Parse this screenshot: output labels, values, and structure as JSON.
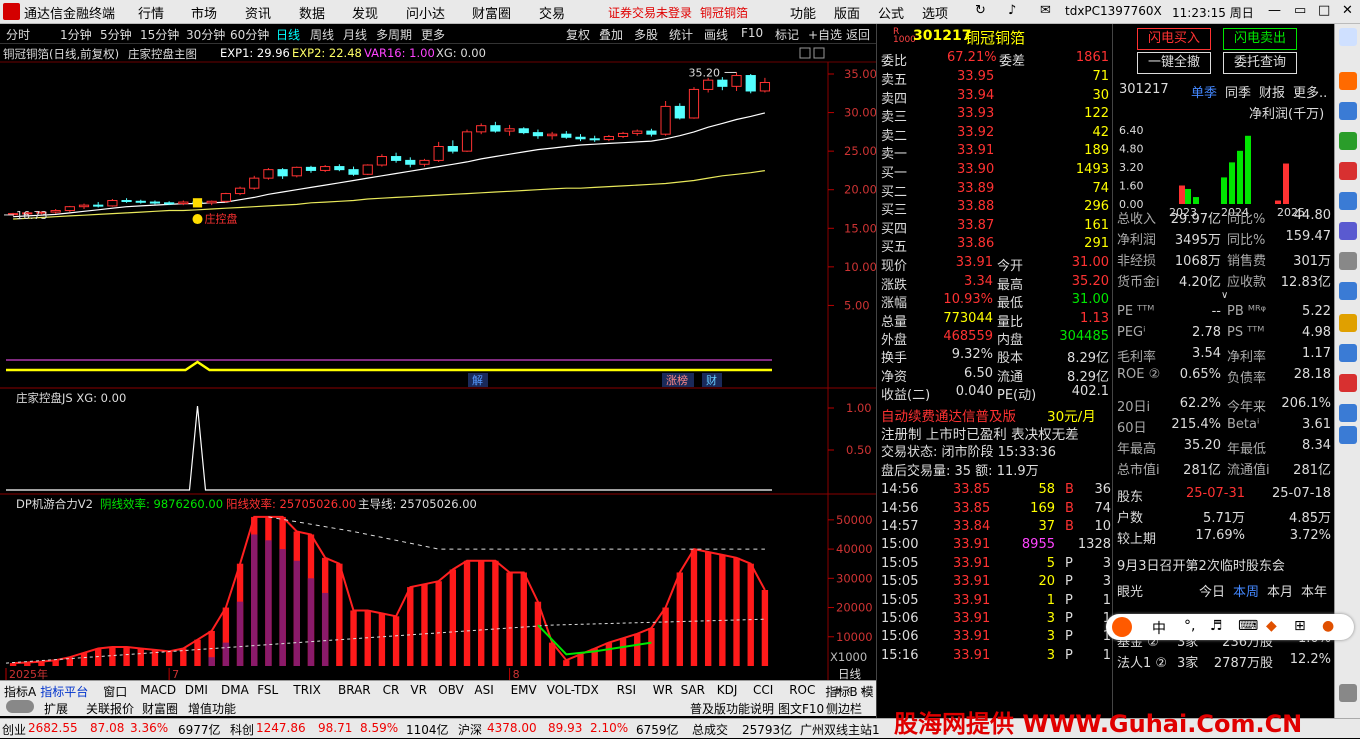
{
  "menu": {
    "app_title": "通达信金融终端",
    "items": [
      "行情",
      "市场",
      "资讯",
      "数据",
      "发现",
      "问小达",
      "财富圈",
      "交易"
    ],
    "login_notice": "证券交易未登录",
    "stock_short": "铜冠铜箔",
    "right_items": [
      "功能",
      "版面",
      "公式",
      "选项"
    ],
    "terminal_id": "tdxPC1397760X",
    "clock": "11:23:15 周日"
  },
  "periods": [
    "分时",
    "1分钟",
    "5分钟",
    "15分钟",
    "30分钟",
    "60分钟",
    "日线",
    "周线",
    "月线",
    "多周期",
    "更多"
  ],
  "toolbar_right": [
    "复权",
    "叠加",
    "多股",
    "统计",
    "画线",
    "F10",
    "标记",
    "+自选",
    "返回"
  ],
  "main_panel": {
    "stock_label": "铜冠铜箔(日线,前复权)",
    "indicator": "庄家控盘主图",
    "exp1": "EXP1: 29.96",
    "exp2": "EXP2: 22.48",
    "var16": "VAR16: 1.00",
    "xg": "XG: 0.00",
    "max_label": "35.20",
    "min_label": "16.73",
    "signal_label": "庄控盘",
    "y_ticks": [
      "35.00",
      "30.00",
      "25.00",
      "20.00",
      "15.00",
      "10.00",
      "5.00"
    ],
    "tags": [
      "解",
      "涨榜",
      "财"
    ]
  },
  "sub1": {
    "title": "庄家控盘JS  XG: 0.00",
    "y_ticks": [
      "1.00",
      "0.50"
    ]
  },
  "sub2": {
    "title": "DP机游合力V2",
    "yin": "阴线效率: 9876260.00",
    "yang": "阳线效率: 25705026.00",
    "main": "主导线: 25705026.00",
    "y_ticks": [
      "50000",
      "40000",
      "30000",
      "20000",
      "10000"
    ],
    "unit": "X1000",
    "period_label": "日线",
    "x_labels": [
      "2025年",
      "7",
      "8"
    ]
  },
  "chart_data": {
    "type": "candlestick",
    "ylim": [
      0,
      37
    ],
    "candles": [
      [
        16.8,
        17,
        16.6,
        16.9
      ],
      [
        16.9,
        17.1,
        16.7,
        17
      ],
      [
        17,
        17.2,
        16.8,
        17.1
      ],
      [
        17.1,
        17.5,
        16.9,
        17.3
      ],
      [
        17.3,
        17.9,
        17.1,
        17.8
      ],
      [
        17.8,
        18.2,
        17.5,
        18
      ],
      [
        18,
        18.4,
        17.7,
        17.9
      ],
      [
        17.9,
        18.8,
        17.8,
        18.6
      ],
      [
        18.6,
        18.9,
        18.3,
        18.5
      ],
      [
        18.5,
        18.7,
        18.2,
        18.4
      ],
      [
        18.4,
        18.6,
        18.1,
        18.3
      ],
      [
        18.3,
        18.5,
        18,
        18.2
      ],
      [
        18.2,
        18.6,
        18,
        18.4
      ],
      [
        18.4,
        18.6,
        18.1,
        18.3
      ],
      [
        18.3,
        18.6,
        18,
        18.5
      ],
      [
        18.5,
        19.6,
        18.3,
        19.5
      ],
      [
        19.5,
        20.4,
        19.3,
        20.2
      ],
      [
        20.2,
        21.8,
        20,
        21.5
      ],
      [
        21.5,
        22.8,
        21.3,
        22.6
      ],
      [
        22.6,
        22.8,
        21.4,
        21.8
      ],
      [
        21.8,
        23,
        21.6,
        22.9
      ],
      [
        22.9,
        23.1,
        22.2,
        22.5
      ],
      [
        22.5,
        23.2,
        22.3,
        23
      ],
      [
        23,
        23.3,
        22.4,
        22.6
      ],
      [
        22.6,
        23,
        21.8,
        22
      ],
      [
        22,
        23.3,
        21.9,
        23.2
      ],
      [
        23.2,
        24.6,
        23,
        24.3
      ],
      [
        24.3,
        24.8,
        23.5,
        23.8
      ],
      [
        23.8,
        24.2,
        22.9,
        23.3
      ],
      [
        23.3,
        24,
        23,
        23.8
      ],
      [
        23.8,
        26.2,
        23.6,
        25.6
      ],
      [
        25.6,
        26.4,
        24.7,
        25
      ],
      [
        25,
        27.8,
        24.9,
        27.5
      ],
      [
        27.5,
        28.6,
        27.2,
        28.3
      ],
      [
        28.3,
        28.8,
        27.4,
        27.6
      ],
      [
        27.6,
        28.4,
        27,
        27.9
      ],
      [
        27.9,
        28.1,
        27.2,
        27.4
      ],
      [
        27.4,
        27.8,
        26.6,
        27
      ],
      [
        27,
        27.5,
        26.5,
        27.2
      ],
      [
        27.2,
        27.6,
        26.6,
        26.8
      ],
      [
        26.8,
        27.2,
        26.3,
        26.6
      ],
      [
        26.6,
        27,
        26.2,
        26.5
      ],
      [
        26.5,
        27.1,
        26.3,
        26.9
      ],
      [
        26.9,
        27.5,
        26.7,
        27.3
      ],
      [
        27.3,
        27.8,
        27,
        27.6
      ],
      [
        27.6,
        27.9,
        26.9,
        27.2
      ],
      [
        27.2,
        31.5,
        27,
        30.8
      ],
      [
        30.8,
        31.2,
        29.1,
        29.3
      ],
      [
        29.3,
        33.3,
        29.2,
        33
      ],
      [
        33,
        34.5,
        32.6,
        34.2
      ],
      [
        34.2,
        34.6,
        32.9,
        33.4
      ],
      [
        33.4,
        35.2,
        32.8,
        34.8
      ],
      [
        34.8,
        35,
        32.5,
        32.8
      ],
      [
        32.8,
        34.5,
        32.6,
        33.9
      ]
    ],
    "ma_short": [
      16.5,
      16.6,
      16.7,
      16.8,
      17,
      17.2,
      17.4,
      17.6,
      17.8,
      17.9,
      18,
      18.1,
      18.2,
      18.2,
      18.3,
      18.4,
      18.7,
      19,
      19.4,
      19.7,
      20,
      20.3,
      20.6,
      20.9,
      21.2,
      21.5,
      21.8,
      22.1,
      22.4,
      22.7,
      23,
      23.3,
      23.6,
      24,
      24.3,
      24.6,
      24.9,
      25.2,
      25.4,
      25.6,
      25.8,
      25.9,
      26,
      26.1,
      26.2,
      26.3,
      26.6,
      27,
      27.5,
      28.1,
      28.6,
      29.1,
      29.5,
      29.96
    ],
    "ma_long": [
      16.2,
      16.3,
      16.4,
      16.5,
      16.6,
      16.7,
      16.8,
      16.9,
      17,
      17.1,
      17.2,
      17.3,
      17.3,
      17.4,
      17.5,
      17.6,
      17.7,
      17.8,
      17.9,
      18,
      18.1,
      18.3,
      18.4,
      18.5,
      18.6,
      18.8,
      18.9,
      19,
      19.1,
      19.2,
      19.3,
      19.4,
      19.5,
      19.6,
      19.7,
      19.8,
      19.9,
      20,
      20.1,
      20.2,
      20.2,
      20.3,
      20.4,
      20.5,
      20.6,
      20.7,
      20.8,
      21,
      21.2,
      21.5,
      21.8,
      22,
      22.2,
      22.48
    ],
    "signal_index": 13,
    "js_spike_index": 13,
    "force_values": [
      1000,
      1200,
      1500,
      2000,
      3000,
      4500,
      6000,
      6500,
      6500,
      6000,
      5500,
      5000,
      6000,
      9000,
      12000,
      20000,
      35000,
      51000,
      51000,
      51000,
      46000,
      45000,
      37000,
      35000,
      19000,
      19000,
      18000,
      17000,
      27000,
      28000,
      29000,
      33000,
      36000,
      36000,
      36000,
      32000,
      32000,
      22000,
      8000,
      2000,
      4000,
      6000,
      8000,
      9500,
      11000,
      13000,
      20000,
      32000,
      40000,
      39000,
      38000,
      37000,
      35000,
      26000
    ],
    "force_purple": [
      0,
      0,
      0,
      0,
      0,
      0,
      0,
      0,
      0,
      0,
      0,
      0,
      0,
      0,
      3000,
      8000,
      22000,
      45000,
      43000,
      40000,
      36000,
      30000,
      25000,
      0,
      0,
      0,
      0,
      0,
      0,
      0,
      0,
      0,
      0,
      0,
      0,
      0,
      0,
      0,
      0,
      0,
      0,
      0,
      0,
      0,
      0,
      0,
      0,
      0,
      0,
      0,
      0,
      0,
      0,
      0
    ]
  },
  "quote": {
    "code": "301217",
    "name": "铜冠铜箔",
    "badge": "R",
    "weibi_label": "委比",
    "weibi": "67.21%",
    "weicha_label": "委差",
    "weicha": "1861",
    "asks": [
      [
        "卖五",
        "33.95",
        "71"
      ],
      [
        "卖四",
        "33.94",
        "30"
      ],
      [
        "卖三",
        "33.93",
        "122"
      ],
      [
        "卖二",
        "33.92",
        "42"
      ],
      [
        "卖一",
        "33.91",
        "189"
      ]
    ],
    "bids": [
      [
        "买一",
        "33.90",
        "1493"
      ],
      [
        "买二",
        "33.89",
        "74"
      ],
      [
        "买三",
        "33.88",
        "296"
      ],
      [
        "买四",
        "33.87",
        "161"
      ],
      [
        "买五",
        "33.86",
        "291"
      ]
    ],
    "stats": [
      [
        "现价",
        "33.91",
        "今开",
        "31.00"
      ],
      [
        "涨跌",
        "3.34",
        "最高",
        "35.20"
      ],
      [
        "涨幅",
        "10.93%",
        "最低",
        "31.00"
      ],
      [
        "总量",
        "773044",
        "量比",
        "1.13"
      ],
      [
        "外盘",
        "468559",
        "内盘",
        "304485"
      ],
      [
        "换手",
        "9.32%",
        "股本",
        "8.29亿"
      ],
      [
        "净资",
        "6.50",
        "流通",
        "8.29亿"
      ],
      [
        "收益(二)",
        "0.040",
        "PE(动)",
        "402.1"
      ]
    ],
    "ad1": "自动续费通达信普及版",
    "ad1_price": "30元/月",
    "ad2": "注册制 上市时已盈利 表决权无差",
    "trade_state": "交易状态: 闭市阶段 15:33:36",
    "after_hours": "盘后交易量: 35  额: 11.9万",
    "ticks": [
      [
        "14:56",
        "33.85",
        "58",
        "B",
        "36"
      ],
      [
        "14:56",
        "33.85",
        "169",
        "B",
        "74"
      ],
      [
        "14:57",
        "33.84",
        "37",
        "B",
        "10"
      ],
      [
        "15:00",
        "33.91",
        "8955",
        "",
        "1328"
      ],
      [
        "15:05",
        "33.91",
        "5",
        "P",
        "3"
      ],
      [
        "15:05",
        "33.91",
        "20",
        "P",
        "3"
      ],
      [
        "15:05",
        "33.91",
        "1",
        "P",
        "1"
      ],
      [
        "15:06",
        "33.91",
        "3",
        "P",
        "1"
      ],
      [
        "15:06",
        "33.91",
        "3",
        "P",
        "1"
      ],
      [
        "15:16",
        "33.91",
        "3",
        "P",
        "1"
      ]
    ]
  },
  "fin": {
    "btn_buy": "闪电买入",
    "btn_sell": "闪电卖出",
    "btn_cancel_all": "一键全撤",
    "btn_query": "委托查询",
    "code": "301217",
    "tabs": [
      "单季",
      "同季",
      "财报",
      "更多.."
    ],
    "chart_title": "净利润(千万)",
    "bar_y": [
      "6.40",
      "4.80",
      "3.20",
      "1.60",
      "0.00"
    ],
    "years": [
      "2023",
      "2024",
      "2025"
    ],
    "rows": [
      [
        "总收入",
        "29.97亿",
        "同比%",
        "44.80"
      ],
      [
        "净利润",
        "3495万",
        "同比%",
        "159.47"
      ],
      [
        "非经损",
        "1068万",
        "销售费",
        "301万"
      ],
      [
        "货币金i",
        "4.20亿",
        "应收款",
        "12.83亿"
      ],
      [
        "PE ᵀᵀᴹ",
        "--",
        "PB ᴹᴿᵠ",
        "5.22"
      ],
      [
        "PEGⁱ",
        "2.78",
        "PS ᵀᵀᴹ",
        "4.98"
      ],
      [
        "毛利率",
        "3.54",
        "净利率",
        "1.17"
      ],
      [
        "ROE ②",
        "0.65%",
        "负债率",
        "28.18"
      ],
      [
        "20日i",
        "62.2%",
        "今年来",
        "206.1%"
      ],
      [
        "60日",
        "215.4%",
        "Betaⁱ",
        "3.61"
      ],
      [
        "年最高",
        "35.20",
        "年最低",
        "8.34"
      ],
      [
        "总市值i",
        "281亿",
        "流通值i",
        "281亿"
      ]
    ],
    "holders": [
      [
        "股东",
        "25-07-31",
        "25-07-18"
      ],
      [
        "户数",
        "5.71万",
        "4.85万"
      ],
      [
        "较上期",
        "17.69%",
        "3.72%"
      ]
    ],
    "notice": "9月3日召开第2次临时股东会",
    "eye_label": "眼光",
    "eye_tabs": [
      "今日",
      "本周",
      "本月",
      "本年"
    ],
    "inst": [
      [
        "基金 ②",
        "3家",
        "236万股",
        "1.0%"
      ],
      [
        "法人1 ②",
        "3家",
        "2787万股",
        "12.2%"
      ]
    ]
  },
  "bottom_tabs": [
    "指标A",
    "指标平台",
    "窗口",
    "MACD",
    "DMI",
    "DMA",
    "FSL",
    "TRIX",
    "BRAR",
    "CR",
    "VR",
    "OBV",
    "ASI",
    "EMV",
    "VOL-TDX",
    "RSI",
    "WR",
    "SAR",
    "KDJ",
    "CCI",
    "ROC",
    "指标B",
    "模 板"
  ],
  "bottom2": [
    "扩展",
    "关联报价",
    "财富圈",
    "增值功能",
    "普及版功能说明",
    "图文F10",
    "侧边栏"
  ],
  "status": [
    [
      "创业",
      "2682.55",
      "87.08",
      "3.36%",
      "6977亿"
    ],
    [
      "科创",
      "1247.86",
      "98.71",
      "8.59%",
      "1104亿"
    ],
    [
      "沪深",
      "4378.00",
      "89.93",
      "2.10%",
      "6759亿"
    ]
  ],
  "status_extra": {
    "total_label": "总成交",
    "total": "25793亿",
    "site": "广州双线主站1"
  },
  "watermark": "股海网提供 WWW.Guhai.Com.CN"
}
